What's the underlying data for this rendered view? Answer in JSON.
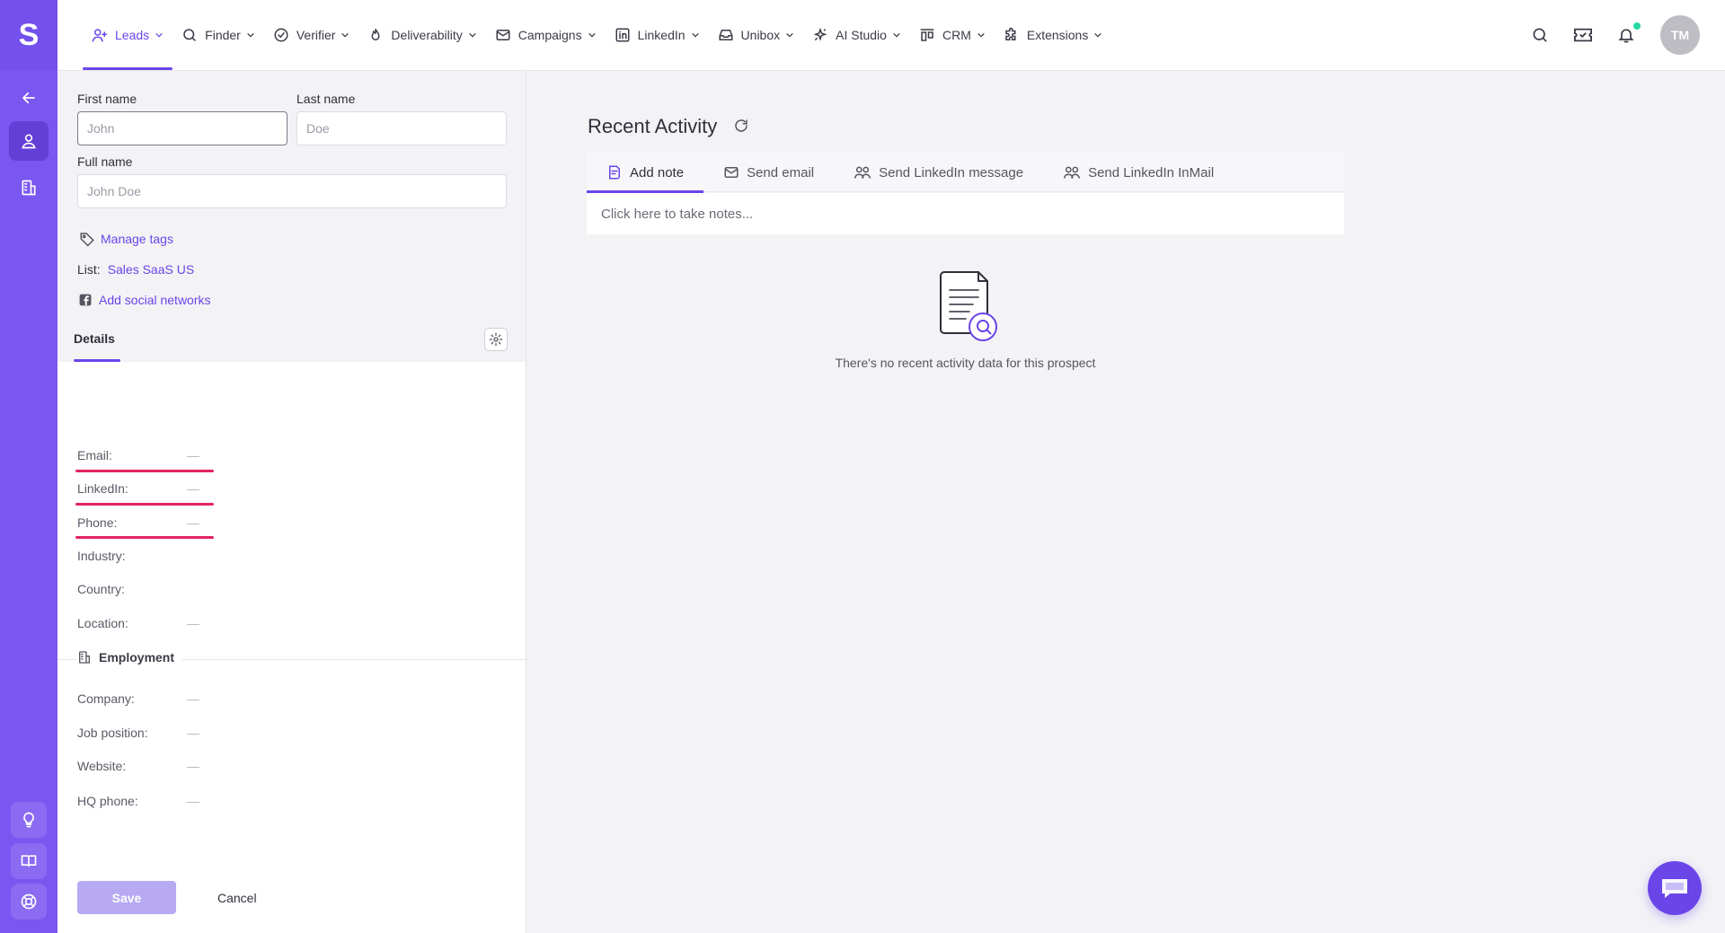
{
  "app": {
    "logo_letter": "S",
    "brand_color": "#7a57f0",
    "accent_color": "#6a45e8"
  },
  "nav": {
    "items": [
      {
        "label": "Leads",
        "icon": "users-icon",
        "active": true
      },
      {
        "label": "Finder",
        "icon": "search-icon"
      },
      {
        "label": "Verifier",
        "icon": "check-circle-icon"
      },
      {
        "label": "Deliverability",
        "icon": "flame-icon"
      },
      {
        "label": "Campaigns",
        "icon": "mail-icon"
      },
      {
        "label": "LinkedIn",
        "icon": "linkedin-icon"
      },
      {
        "label": "Unibox",
        "icon": "inbox-icon"
      },
      {
        "label": "AI Studio",
        "icon": "sparkle-icon"
      },
      {
        "label": "CRM",
        "icon": "crm-icon"
      },
      {
        "label": "Extensions",
        "icon": "puzzle-icon"
      }
    ],
    "avatar_initials": "TM",
    "notification_dot_color": "#26d7a4"
  },
  "form": {
    "first_name": {
      "label": "First name",
      "placeholder": "John"
    },
    "last_name": {
      "label": "Last name",
      "placeholder": "Doe"
    },
    "full_name": {
      "label": "Full name",
      "placeholder": "John Doe"
    },
    "manage_tags": "Manage tags",
    "list_label": "List:",
    "list_value": "Sales SaaS US",
    "add_social": "Add social networks",
    "details_tab": "Details",
    "fields": [
      {
        "label": "Email:",
        "value": "—"
      },
      {
        "label": "LinkedIn:",
        "value": "—"
      },
      {
        "label": "Phone:",
        "value": "—"
      },
      {
        "label": "Industry:",
        "value": ""
      },
      {
        "label": "Country:",
        "value": ""
      },
      {
        "label": "Location:",
        "value": "—"
      }
    ],
    "employment_heading": "Employment",
    "employment_fields": [
      {
        "label": "Company:",
        "value": "—"
      },
      {
        "label": "Job position:",
        "value": "—"
      },
      {
        "label": "Website:",
        "value": "—"
      },
      {
        "label": "HQ phone:",
        "value": "—"
      }
    ],
    "save_label": "Save",
    "cancel_label": "Cancel"
  },
  "activity": {
    "title": "Recent Activity",
    "tabs": [
      {
        "label": "Add note",
        "icon": "note-icon",
        "active": true
      },
      {
        "label": "Send email",
        "icon": "mail-icon"
      },
      {
        "label": "Send LinkedIn message",
        "icon": "users-icon"
      },
      {
        "label": "Send LinkedIn InMail",
        "icon": "users-icon"
      }
    ],
    "notes_placeholder": "Click here to take notes...",
    "empty_text": "There's no recent activity data for this prospect"
  }
}
